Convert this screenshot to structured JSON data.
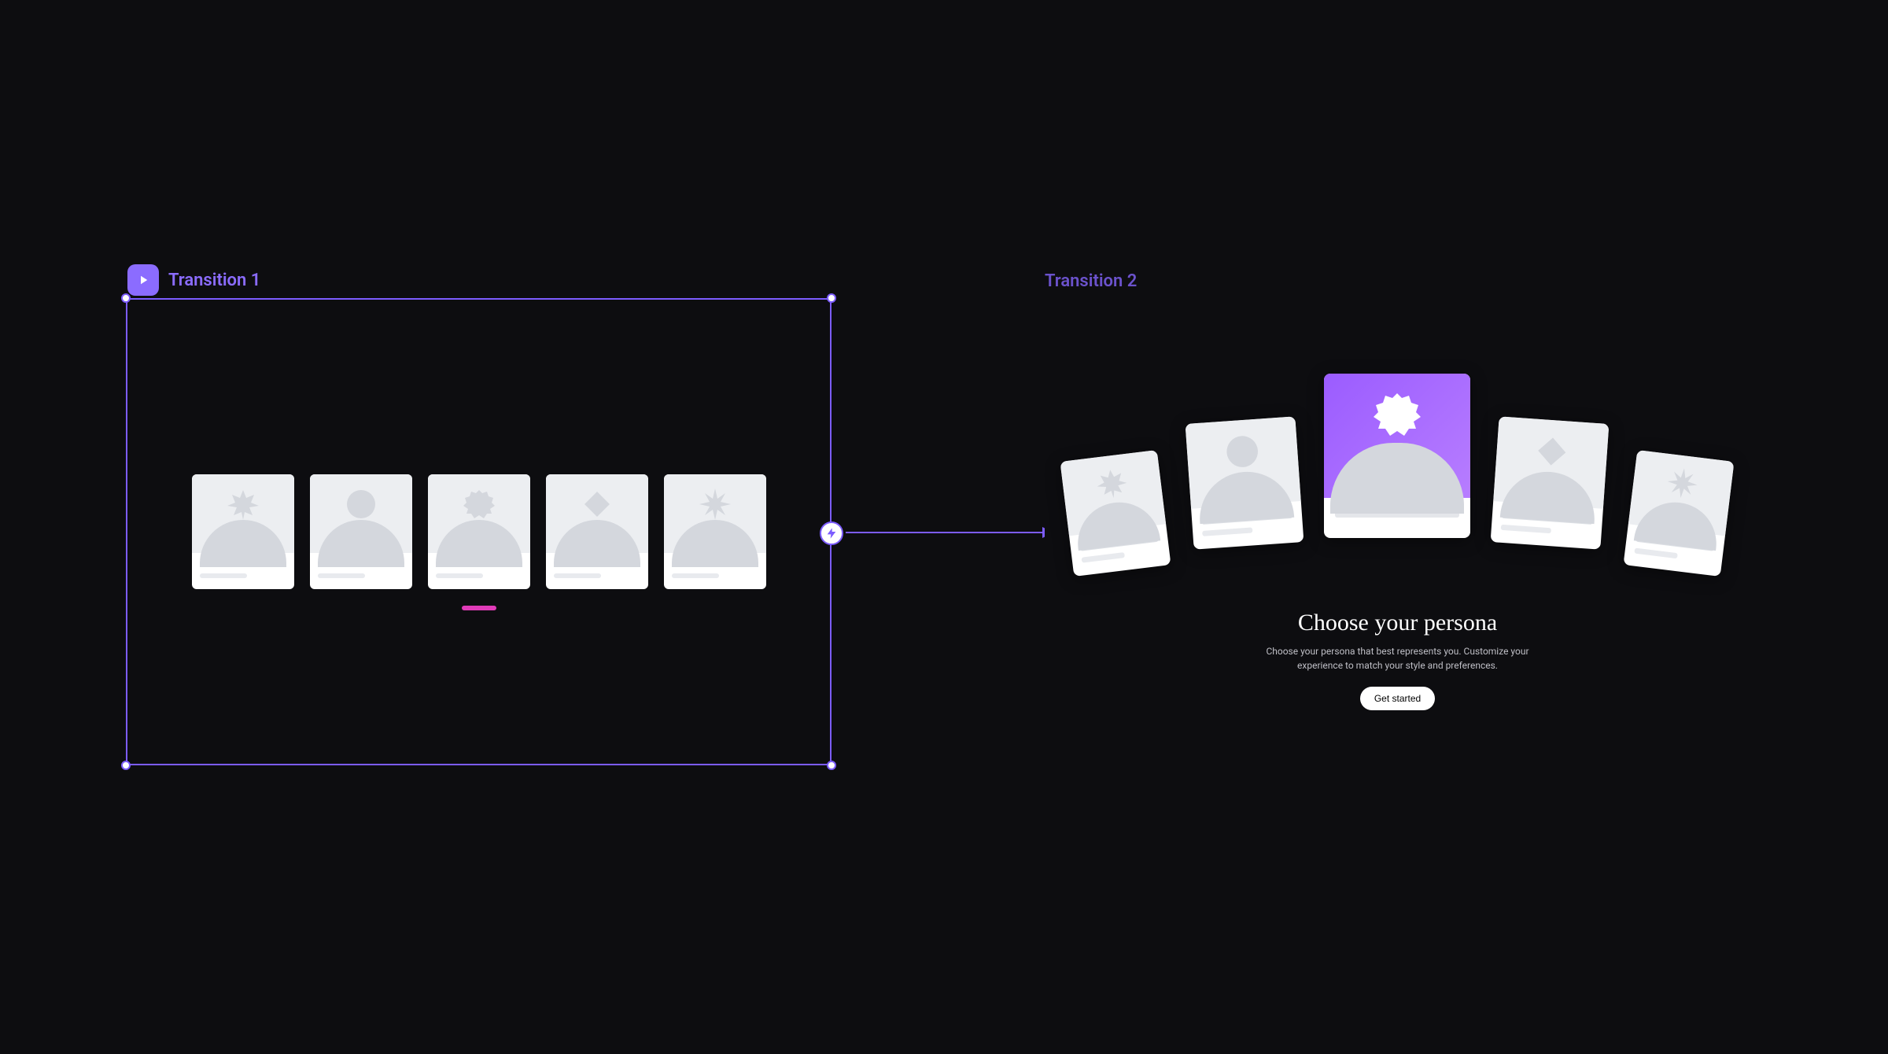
{
  "frames": {
    "frame1": {
      "label": "Transition 1",
      "selected": true
    },
    "frame2": {
      "label": "Transition 2"
    }
  },
  "frame2_content": {
    "title": "Choose your persona",
    "subtitle": "Choose your persona that best represents you. Customize your experience to match your style and preferences.",
    "button": "Get started"
  },
  "colors": {
    "accent": "#7c5cff",
    "pink": "#e03bb8"
  }
}
